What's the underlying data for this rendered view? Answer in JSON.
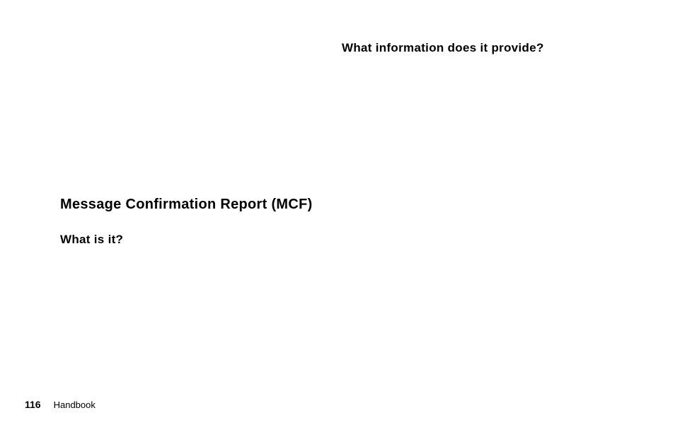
{
  "content": {
    "right_column_heading": "What information does it provide?",
    "section_title": "Message Confirmation Report (MCF)",
    "subheading": "What is it?"
  },
  "footer": {
    "page_number": "116",
    "label": "Handbook"
  }
}
